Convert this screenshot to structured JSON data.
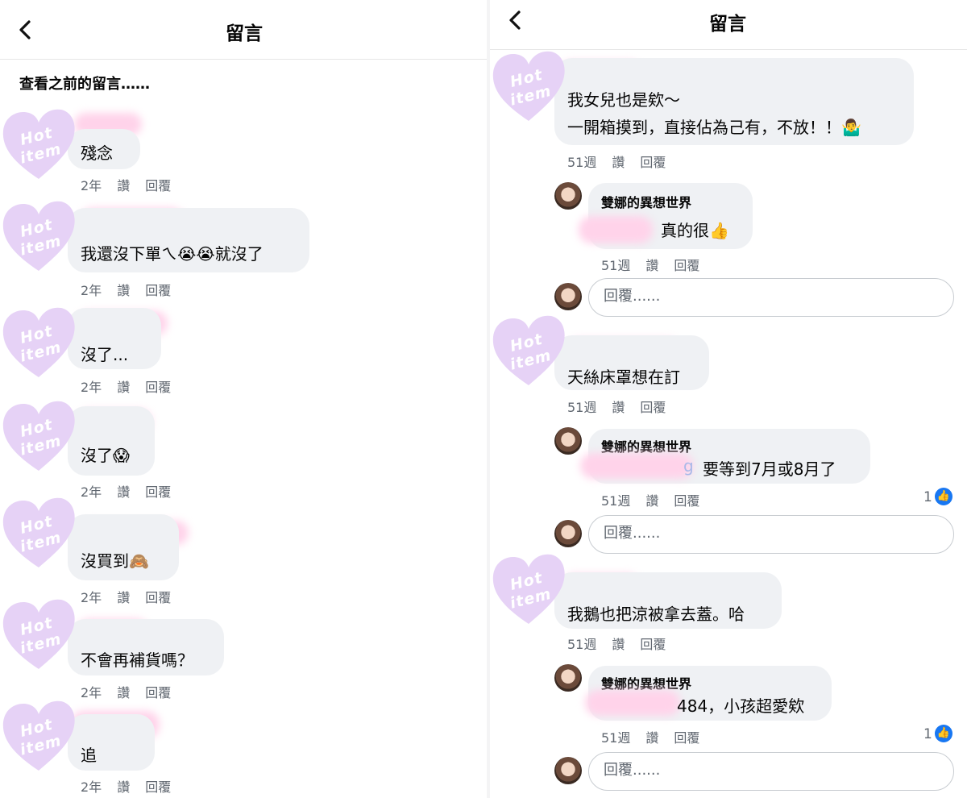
{
  "header": {
    "title": "留言"
  },
  "older_comments_label": "查看之前的留言……",
  "watermark": {
    "line1": "Hot",
    "line2": "item",
    "color": "#e6d2f6"
  },
  "meta": {
    "age_2y": "2年",
    "age_51w": "51週",
    "read": "讚",
    "reply": "回覆"
  },
  "left_comments": [
    {
      "text": "殘念"
    },
    {
      "text": "我還沒下單ㄟ😭😭就沒了"
    },
    {
      "text": "沒了..."
    },
    {
      "text": "沒了😱"
    },
    {
      "text": "沒買到🙈"
    },
    {
      "text": "不會再補貨嗎？"
    },
    {
      "text": "追"
    }
  ],
  "right": {
    "thread1": {
      "line1": "我女兒也是欸～",
      "line2": "一開箱摸到，直接佔為己有，不放！！🤷‍♂️",
      "reply_name": "雙娜的異想世界",
      "reply_text": "真的很👍"
    },
    "thread2": {
      "text": "天絲床罩想在訂",
      "reply_name": "雙娜的異想世界",
      "reply_tag_tail": "g",
      "reply_text": "要等到7月或8月了",
      "likes": "1"
    },
    "thread3": {
      "text": "我鵝也把涼被拿去蓋。哈",
      "reply_name": "雙娜的異想世界",
      "reply_text": "484，小孩超愛欸",
      "likes": "1"
    },
    "reply_placeholder": "回覆......"
  },
  "icons": {
    "back": "chevron-left-icon",
    "like": "thumbs-up-icon",
    "like_color": "#1877f2"
  }
}
